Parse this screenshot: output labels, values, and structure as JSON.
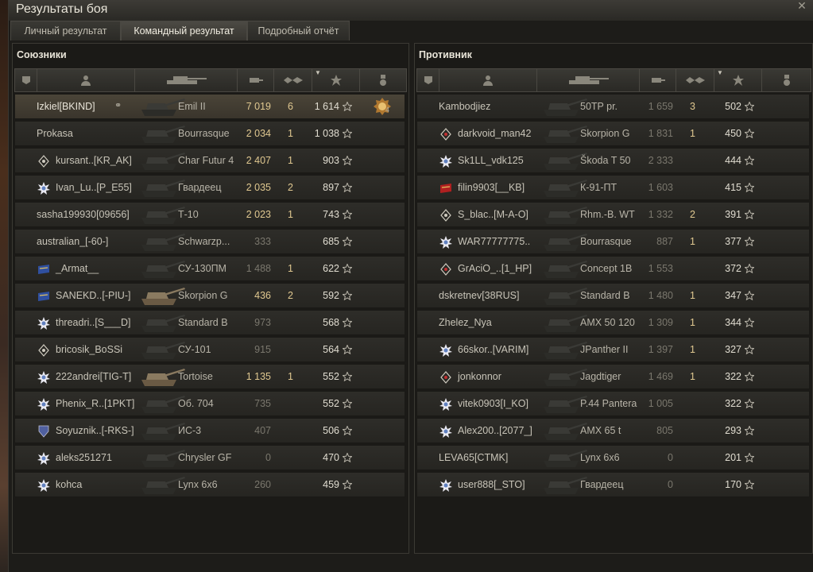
{
  "window": {
    "title": "Результаты боя"
  },
  "tabs": [
    {
      "label": "Личный результат"
    },
    {
      "label": "Командный результат"
    },
    {
      "label": "Подробный отчёт"
    }
  ],
  "allies": {
    "title": "Союзники",
    "rows": [
      {
        "name": "Izkiel[BKIND]",
        "tank": "Emil II",
        "damage": "7 019",
        "kills": "6",
        "xp": "1 614",
        "badge": "none",
        "self": true,
        "medal": "4",
        "platoon": "platoon-icon"
      },
      {
        "name": "Prokasa",
        "tank": "Bourrasque",
        "damage": "2 034",
        "kills": "1",
        "xp": "1 038",
        "badge": "none"
      },
      {
        "name": "kursant..[KR_AK]",
        "tank": "Char Futur 4",
        "damage": "2 407",
        "kills": "1",
        "xp": "903",
        "badge": "diamond"
      },
      {
        "name": "Ivan_Lu..[P_E55]",
        "tank": "Гвардеец",
        "damage": "2 035",
        "kills": "2",
        "xp": "897",
        "badge": "star"
      },
      {
        "name": "sasha199930[09656]",
        "tank": "Т-10",
        "damage": "2 023",
        "kills": "1",
        "xp": "743",
        "badge": "none"
      },
      {
        "name": "australian_[-60-]",
        "tank": "Schwarzp...",
        "damage": "333",
        "kills": "",
        "xp": "685",
        "badge": "none"
      },
      {
        "name": "_Armat__",
        "tank": "СУ-130ПМ",
        "damage": "1 488",
        "kills": "1",
        "xp": "622",
        "badge": "flag-blue"
      },
      {
        "name": "SANEKD..[-PIU-]",
        "tank": "Skorpion G",
        "damage": "436",
        "kills": "2",
        "xp": "592",
        "badge": "flag-blue"
      },
      {
        "name": "threadri..[S___D]",
        "tank": "Standard B",
        "damage": "973",
        "kills": "",
        "xp": "568",
        "badge": "star"
      },
      {
        "name": "bricosik_BoSSi",
        "tank": "СУ-101",
        "damage": "915",
        "kills": "",
        "xp": "564",
        "badge": "diamond"
      },
      {
        "name": "222andrei[TIG-T]",
        "tank": "Tortoise",
        "damage": "1 135",
        "kills": "1",
        "xp": "552",
        "badge": "star"
      },
      {
        "name": "Phenix_R..[1PKT]",
        "tank": "Об. 704",
        "damage": "735",
        "kills": "",
        "xp": "552",
        "badge": "star"
      },
      {
        "name": "Soyuznik..[-RKS-]",
        "tank": "ИС-3",
        "damage": "407",
        "kills": "",
        "xp": "506",
        "badge": "shield"
      },
      {
        "name": "aleks251271",
        "tank": "Chrysler GF",
        "damage": "0",
        "kills": "",
        "xp": "470",
        "badge": "star"
      },
      {
        "name": "kohca",
        "tank": "Lynx 6x6",
        "damage": "260",
        "kills": "",
        "xp": "459",
        "badge": "star"
      }
    ]
  },
  "enemies": {
    "title": "Противник",
    "rows": [
      {
        "name": "Kambodjiez",
        "tank": "50TP pr.",
        "damage": "1 659",
        "kills": "3",
        "xp": "502",
        "badge": "none"
      },
      {
        "name": "darkvoid_man42",
        "tank": "Skorpion G",
        "damage": "1 831",
        "kills": "1",
        "xp": "450",
        "badge": "diamond-red"
      },
      {
        "name": "Sk1LL_vdk125",
        "tank": "Škoda T 50",
        "damage": "2 333",
        "kills": "",
        "xp": "444",
        "badge": "star"
      },
      {
        "name": "filin9903[__KB]",
        "tank": "К-91-ПТ",
        "damage": "1 603",
        "kills": "",
        "xp": "415",
        "badge": "flag-red"
      },
      {
        "name": "S_blac..[M-A-O]",
        "tank": "Rhm.-B. WT",
        "damage": "1 332",
        "kills": "2",
        "xp": "391",
        "badge": "diamond"
      },
      {
        "name": "WAR77777775..",
        "tank": "Bourrasque",
        "damage": "887",
        "kills": "1",
        "xp": "377",
        "badge": "star"
      },
      {
        "name": "GrAciO_..[1_HP]",
        "tank": "Concept 1B",
        "damage": "1 553",
        "kills": "",
        "xp": "372",
        "badge": "diamond-red"
      },
      {
        "name": "dskretnev[38RUS]",
        "tank": "Standard B",
        "damage": "1 480",
        "kills": "1",
        "xp": "347",
        "badge": "none"
      },
      {
        "name": "Zhelez_Nya",
        "tank": "AMX 50 120",
        "damage": "1 309",
        "kills": "1",
        "xp": "344",
        "badge": "none"
      },
      {
        "name": "66skor..[VARIM]",
        "tank": "JPanther II",
        "damage": "1 397",
        "kills": "1",
        "xp": "327",
        "badge": "star"
      },
      {
        "name": "jonkonnor",
        "tank": "Jagdtiger",
        "damage": "1 469",
        "kills": "1",
        "xp": "322",
        "badge": "diamond-red"
      },
      {
        "name": "vitek0903[I_KO]",
        "tank": "P.44 Pantera",
        "damage": "1 005",
        "kills": "",
        "xp": "322",
        "badge": "star"
      },
      {
        "name": "Alex200..[2077_]",
        "tank": "AMX 65 t",
        "damage": "805",
        "kills": "",
        "xp": "293",
        "badge": "star"
      },
      {
        "name": "LEVA65[CTMK]",
        "tank": "Lynx 6x6",
        "damage": "0",
        "kills": "",
        "xp": "201",
        "badge": "none"
      },
      {
        "name": "user888[_STO]",
        "tank": "Гвардеец",
        "damage": "0",
        "kills": "",
        "xp": "170",
        "badge": "star"
      }
    ]
  },
  "colors": {
    "accent": "#e0c890",
    "text": "#c8c4b8",
    "muted": "#7a776d"
  }
}
